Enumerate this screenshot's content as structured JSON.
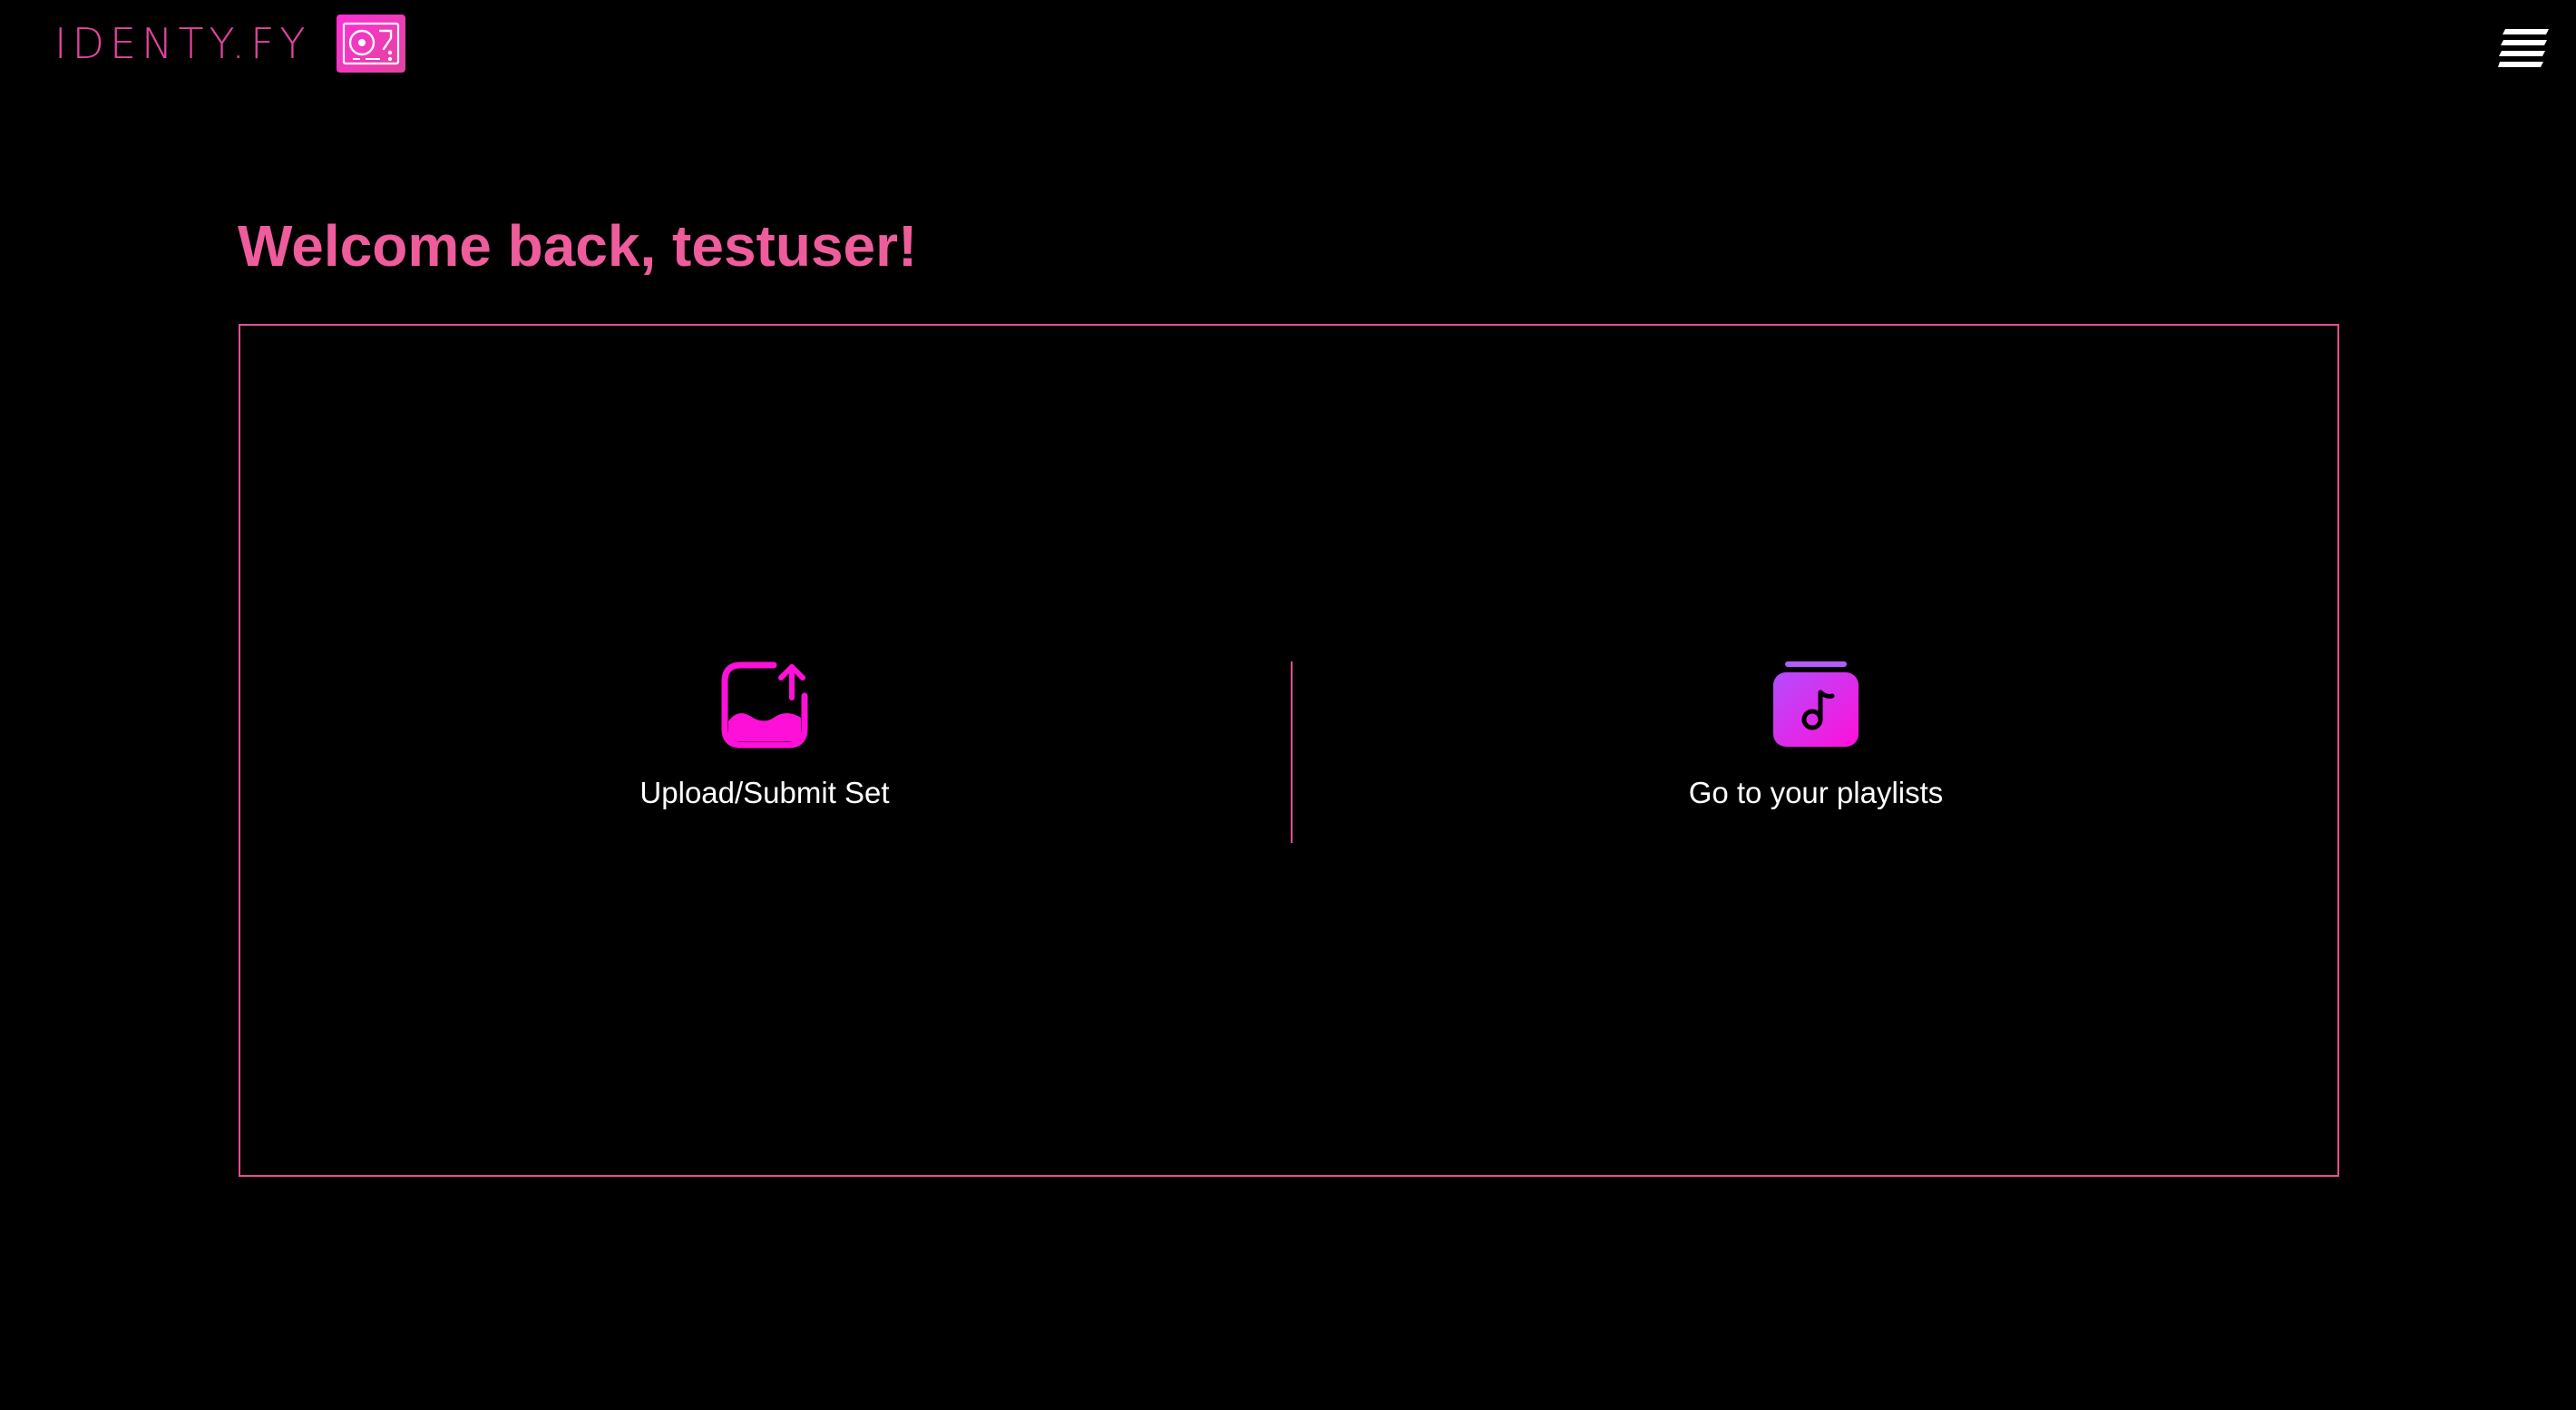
{
  "header": {
    "logo_text": "IDENTY.FY",
    "logo_icon": "turntable-icon",
    "menu_icon": "hamburger-menu-icon"
  },
  "main": {
    "welcome_text": "Welcome back, testuser!",
    "actions": [
      {
        "label": "Upload/Submit Set",
        "icon": "image-upload-icon"
      },
      {
        "label": "Go to your playlists",
        "icon": "music-playlist-icon"
      }
    ]
  },
  "colors": {
    "background": "#000000",
    "accent_pink": "#ee5c9c",
    "accent_magenta": "#ff1fd8",
    "accent_purple": "#b44cff",
    "text": "#ffffff"
  }
}
